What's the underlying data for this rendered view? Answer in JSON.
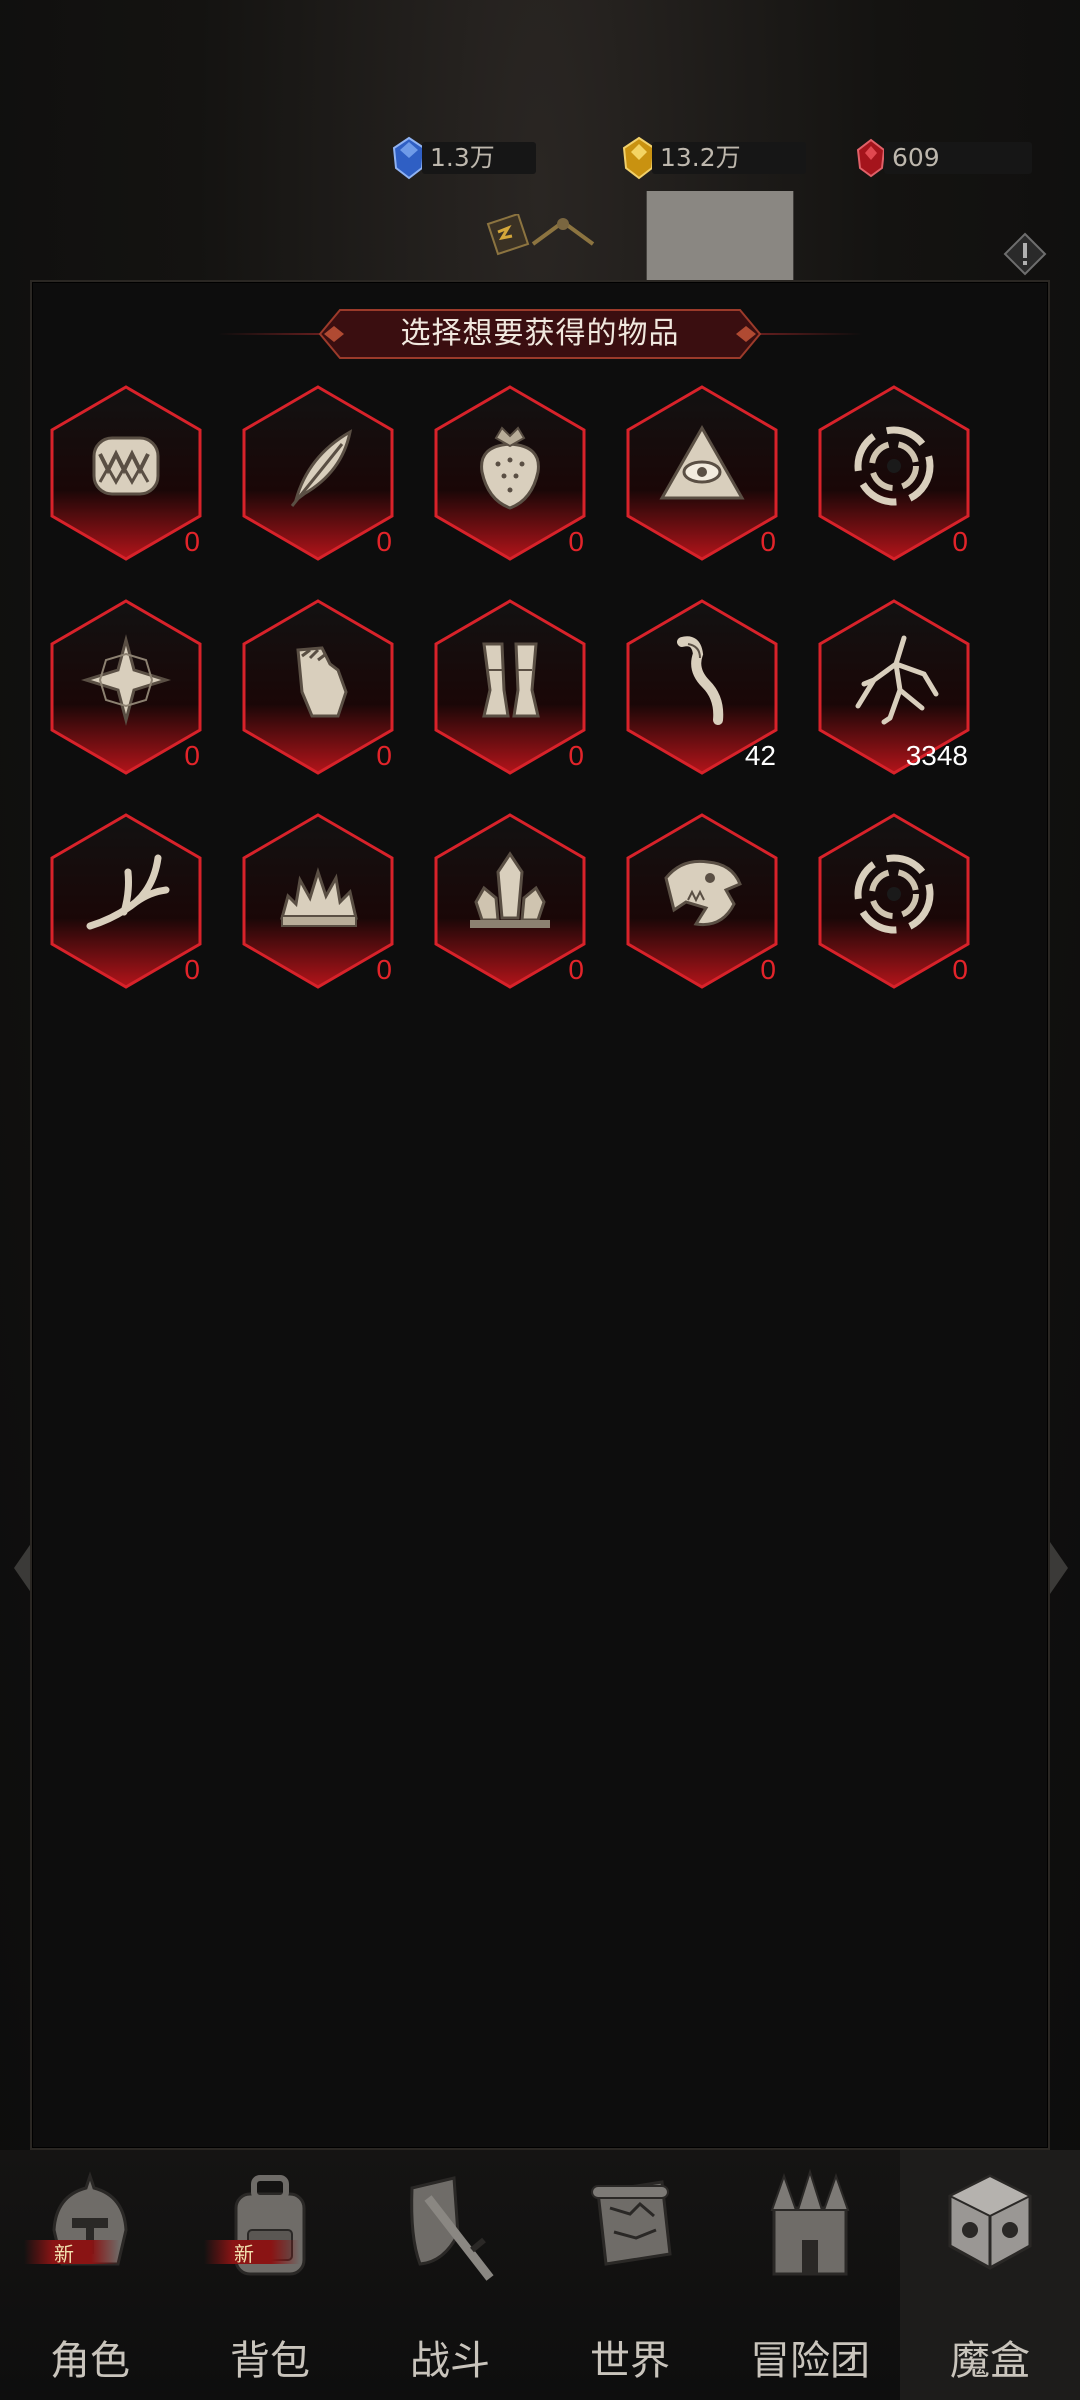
{
  "currencies": [
    {
      "name": "blue-gem",
      "value": "1.3万",
      "color": "#2f6fd6",
      "has_plus": true
    },
    {
      "name": "gold-gem",
      "value": "13.2万",
      "color": "#d4a018",
      "has_plus": true
    },
    {
      "name": "red-gem",
      "value": "609",
      "color": "#c3202a",
      "has_plus": false
    }
  ],
  "dialog": {
    "title": "选择想要获得的物品"
  },
  "items": [
    {
      "icon": "fangs-icon",
      "count": "0"
    },
    {
      "icon": "feather-icon",
      "count": "0"
    },
    {
      "icon": "strawberry-icon",
      "count": "0"
    },
    {
      "icon": "eye-pyramid-icon",
      "count": "0"
    },
    {
      "icon": "vortex-icon",
      "count": "0"
    },
    {
      "icon": "star-crystal-icon",
      "count": "0"
    },
    {
      "icon": "gauntlet-icon",
      "count": "0"
    },
    {
      "icon": "greaves-icon",
      "count": "0"
    },
    {
      "icon": "hair-lock-icon",
      "count": "42"
    },
    {
      "icon": "roots-icon",
      "count": "3348"
    },
    {
      "icon": "antler-icon",
      "count": "0"
    },
    {
      "icon": "spiky-shell-icon",
      "count": "0"
    },
    {
      "icon": "crystal-cluster-icon",
      "count": "0"
    },
    {
      "icon": "beast-skull-icon",
      "count": "0"
    },
    {
      "icon": "vortex-icon",
      "count": "0"
    }
  ],
  "nav": [
    {
      "label": "角色",
      "icon": "helmet-icon",
      "badge": "新",
      "active": false
    },
    {
      "label": "背包",
      "icon": "backpack-icon",
      "badge": "新",
      "active": false
    },
    {
      "label": "战斗",
      "icon": "shield-sword-icon",
      "badge": "",
      "active": false
    },
    {
      "label": "世界",
      "icon": "map-scroll-icon",
      "badge": "",
      "active": false
    },
    {
      "label": "冒险团",
      "icon": "castle-icon",
      "badge": "",
      "active": false
    },
    {
      "label": "魔盒",
      "icon": "magic-cube-icon",
      "badge": "",
      "active": true
    }
  ],
  "colors": {
    "accent_red": "#e2242a",
    "panel_bg": "#0d0d0d"
  }
}
